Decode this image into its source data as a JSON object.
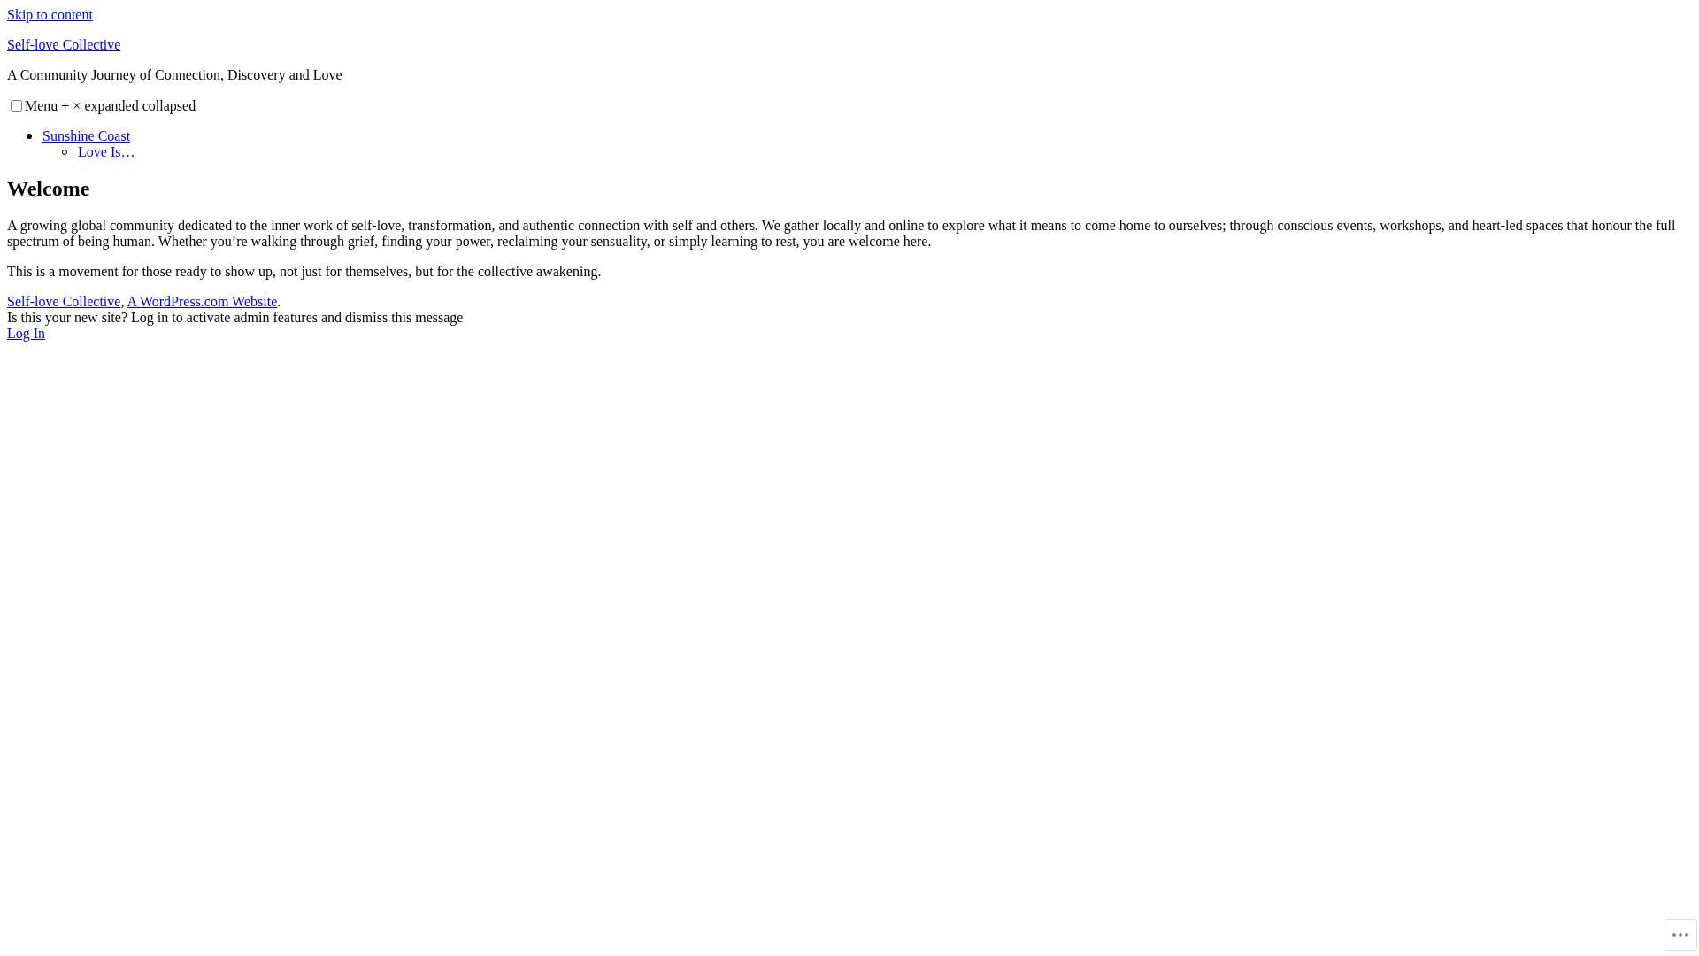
{
  "skip_link": "Skip to content",
  "site_title": "Self-love Collective",
  "tagline": "A Community Journey of Connection, Discovery and Love",
  "menu_toggle": {
    "checked": false,
    "labels": [
      "Menu",
      "+",
      "×",
      "expanded",
      "collapsed"
    ]
  },
  "menu": [
    {
      "label": "Sunshine Coast",
      "children": [
        {
          "label": "Love Is…"
        }
      ]
    }
  ],
  "heading": "Welcome",
  "paragraphs": [
    "A growing global community dedicated to the inner work of self-love, transformation, and authentic connection with self and others. We gather locally and online to explore what it means to come home to ourselves; through conscious events, workshops, and heart-led spaces that honour the full spectrum of being human. Whether you’re walking through grief, finding your power, reclaiming your sensuality, or simply learning to rest, you are welcome here.",
    "This is a movement for those ready to show up, not just for themselves, but for the collective awakening."
  ],
  "footer": {
    "links": [
      "Self-love Collective",
      "A WordPress.com Website"
    ],
    "separator": ", ",
    "end": "."
  },
  "notice": {
    "message": "Is this your new site? Log in to activate admin features and dismiss this message",
    "link": "Log In"
  }
}
